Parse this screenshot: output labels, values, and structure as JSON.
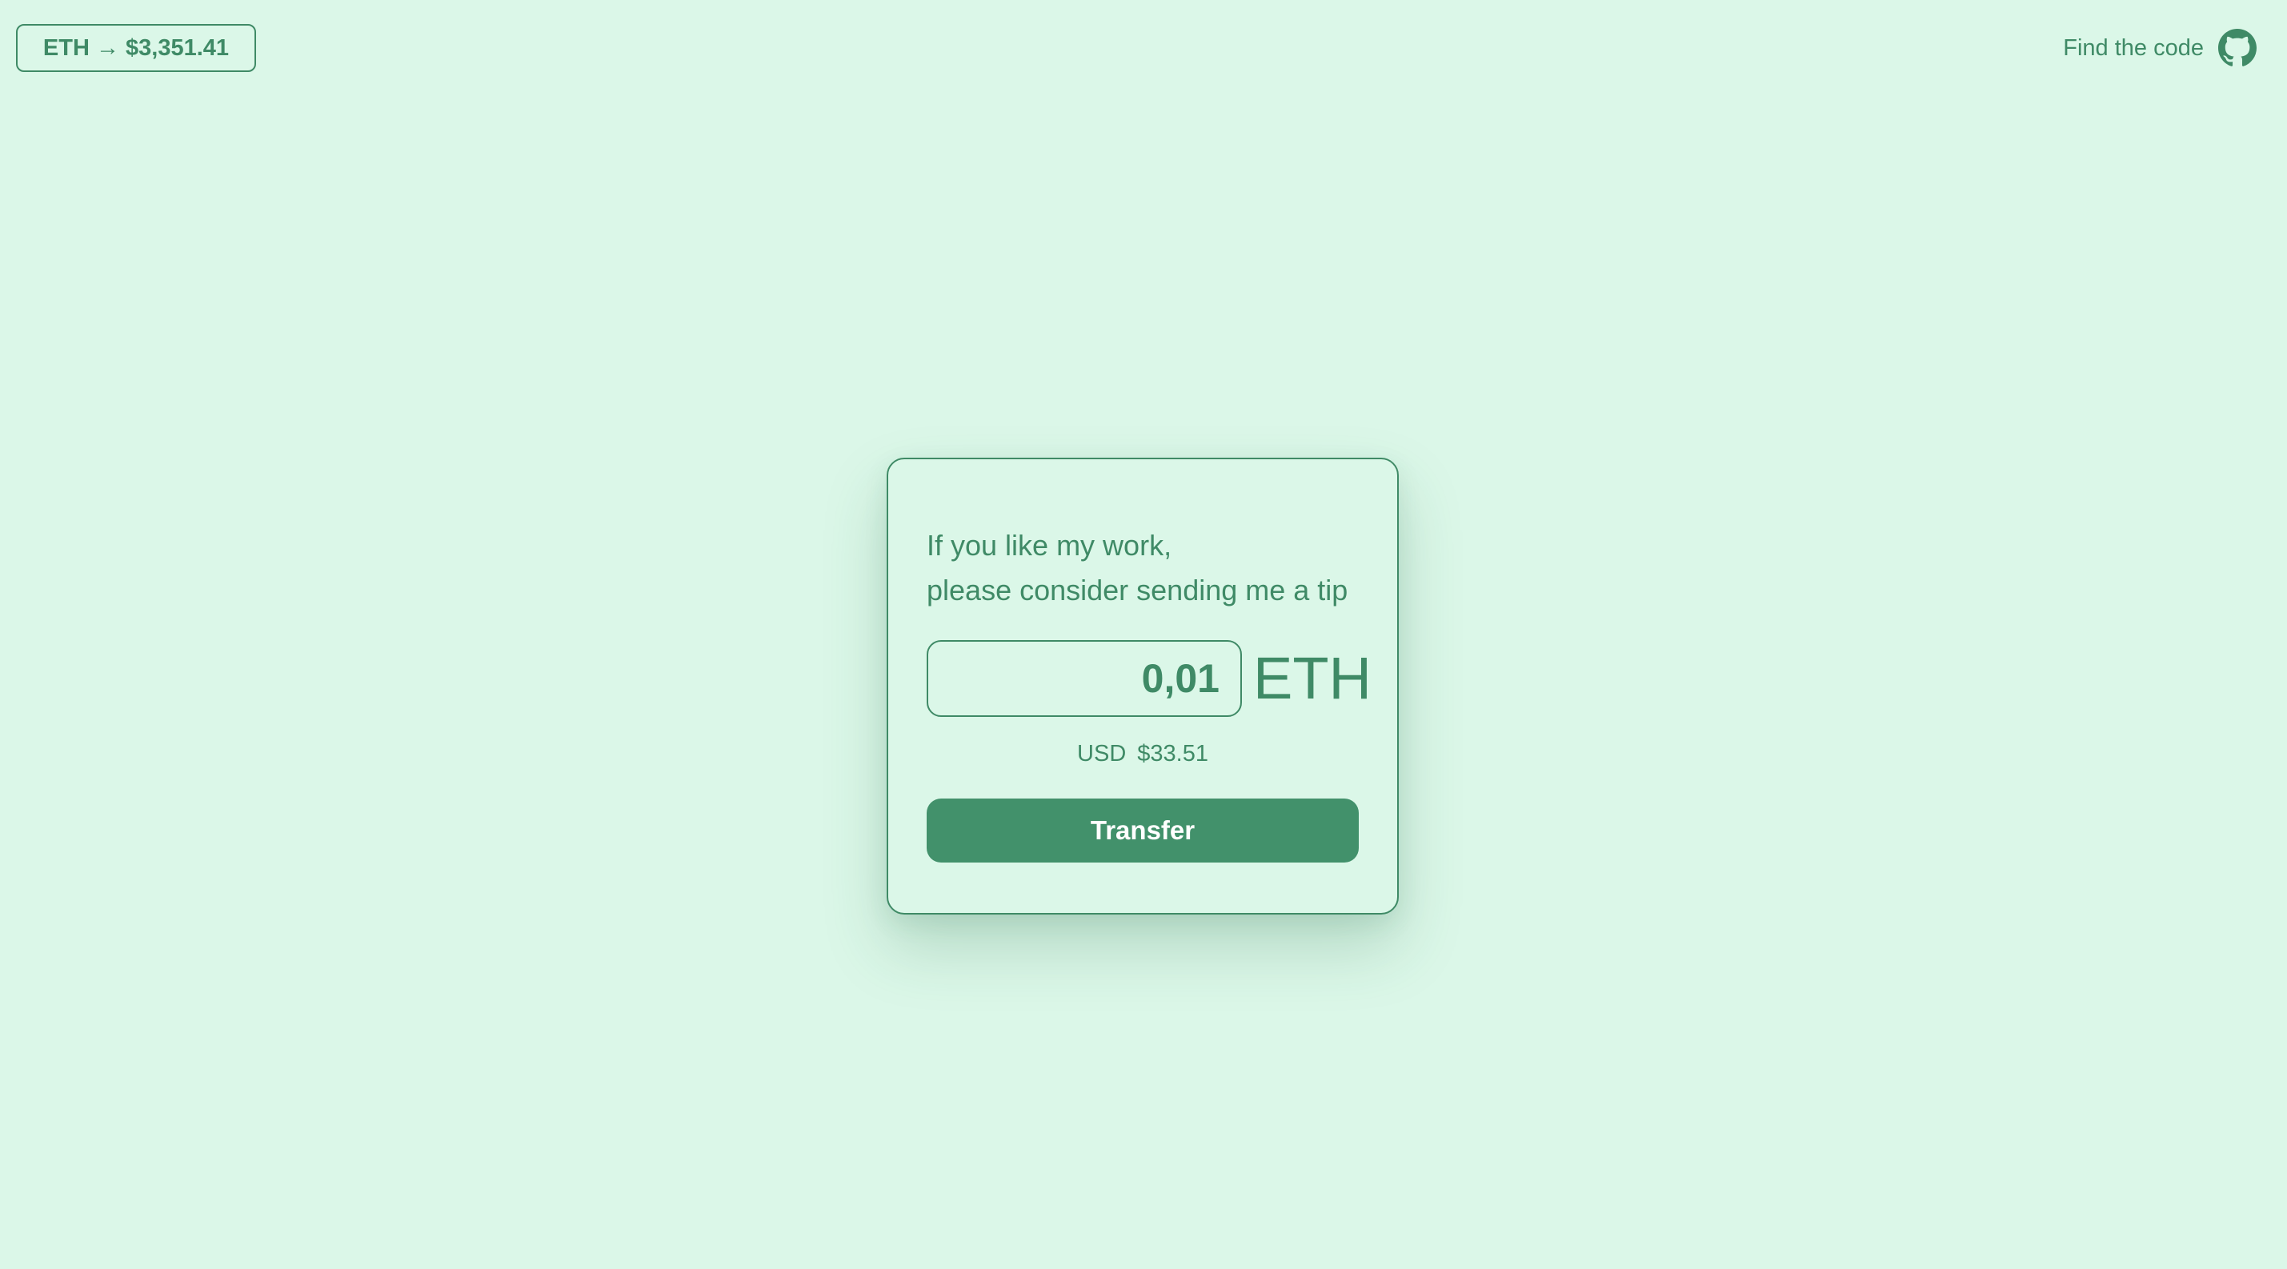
{
  "header": {
    "price_badge": "ETH → $3,351.41",
    "code_link_label": "Find the code",
    "code_link_icon": "github-icon"
  },
  "card": {
    "message_line1": "If you like my work,",
    "message_line2": "please consider sending me a tip",
    "amount_value": "0,01",
    "currency": "ETH",
    "usd_label": "USD",
    "usd_value": "$33.51",
    "transfer_label": "Transfer"
  },
  "colors": {
    "background": "#dbf7e8",
    "accent": "#42916b",
    "text": "#3f8a66"
  }
}
